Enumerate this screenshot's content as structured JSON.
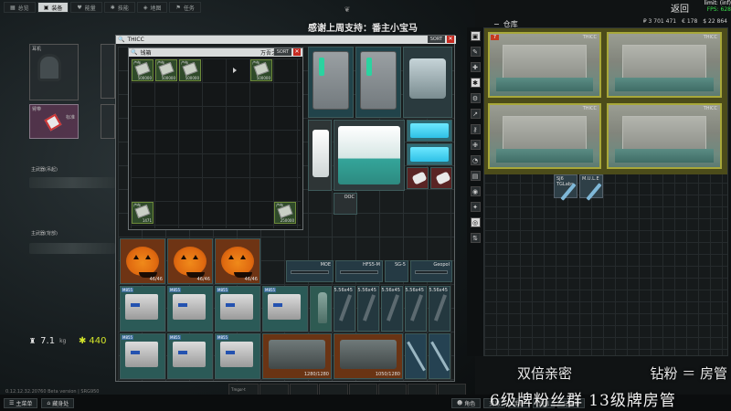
{
  "topbar": {
    "tabs": [
      {
        "label": "总览",
        "icon": "chart-icon"
      },
      {
        "label": "装备",
        "icon": "shirt-icon",
        "active": true
      },
      {
        "label": "能量",
        "icon": "heart-icon"
      },
      {
        "label": "技能",
        "icon": "gear-icon"
      },
      {
        "label": "地图",
        "icon": "map-icon"
      },
      {
        "label": "任务",
        "icon": "flag-icon"
      }
    ]
  },
  "banner": {
    "title": "感谢上周支持：番主小宝马"
  },
  "header_right": {
    "back": "返回",
    "limit": "limit: (inf)",
    "fps": "FPS: 628",
    "warehouse": "仓库",
    "rubles": "₽ 3 701 471",
    "euros": "€ 178",
    "dollars": "$ 22 864"
  },
  "character": {
    "slots": {
      "earpiece": "耳机",
      "armband": "臂带",
      "armband_item": "标准",
      "primary1": "主武器(吊起)",
      "primary2": "主武器(背部)"
    },
    "weight": "7.1",
    "weight_unit": "kg",
    "money": "440"
  },
  "thicc": {
    "title": "THICC",
    "sort": "SORT"
  },
  "wallet": {
    "title": "钱箱",
    "count_label": "万吾之盒",
    "sort": "SORT",
    "bills": [
      {
        "name": "卢布",
        "count": "500000"
      },
      {
        "name": "卢布",
        "count": "500000"
      },
      {
        "name": "卢布",
        "count": "500000"
      },
      {
        "name": "卢布",
        "count": "500000"
      },
      {
        "name": "卢布",
        "count": "1471"
      },
      {
        "name": "卢布",
        "count": "250000"
      }
    ]
  },
  "thicc_items": {
    "cooler_label": "MRG",
    "pumpkin_count": "46/46",
    "case_count_a": "1280/1280",
    "case_count_b": "1050/1280",
    "ammo_label": "M855",
    "mag_labels": [
      "5.56x45",
      "5.56x45",
      "5.56x45",
      "5.56x45",
      "5.56x45"
    ],
    "gun_names": [
      "MOE",
      "HFS5-M",
      "SG-5",
      "Geopol"
    ],
    "misc_name": "OOC"
  },
  "stash": {
    "case_labels": [
      "THICC",
      "THICC",
      "THICC",
      "THICC"
    ],
    "knife_labels": [
      "SJ6 TGLabs",
      "M.U.L.E"
    ]
  },
  "bottom": {
    "main_menu": "主菜单",
    "hideout": "藏身处",
    "version": "0.12.12.32.20760 Beta version | SRG950",
    "character": "角色",
    "trade": "交易",
    "handbook": "手册",
    "messages": "消息",
    "notes": "记事本",
    "thumb_label": "Tmgor-t"
  },
  "overlay": {
    "line1_a": "双倍亲密",
    "line1_b": "钻粉 ＝ 房管",
    "line2": "6级牌粉丝群  13级牌房管"
  }
}
